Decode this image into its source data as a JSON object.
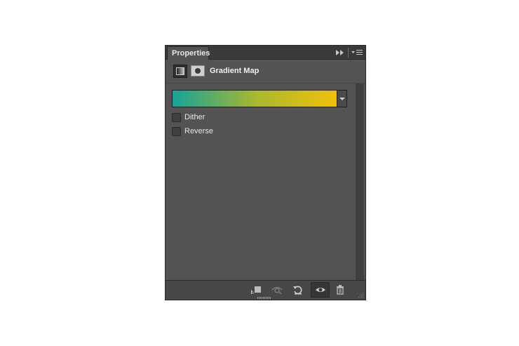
{
  "panel": {
    "tab_label": "Properties",
    "adjustment_title": "Gradient Map"
  },
  "gradient": {
    "colors": [
      "#16A399",
      "#ABB82E",
      "#F4C208"
    ]
  },
  "options": {
    "dither_label": "Dither",
    "reverse_label": "Reverse"
  },
  "footer": {
    "icons": [
      "clip-to-layer-icon",
      "view-previous-state-icon",
      "reset-icon",
      "visibility-eye-icon",
      "trash-icon"
    ]
  }
}
